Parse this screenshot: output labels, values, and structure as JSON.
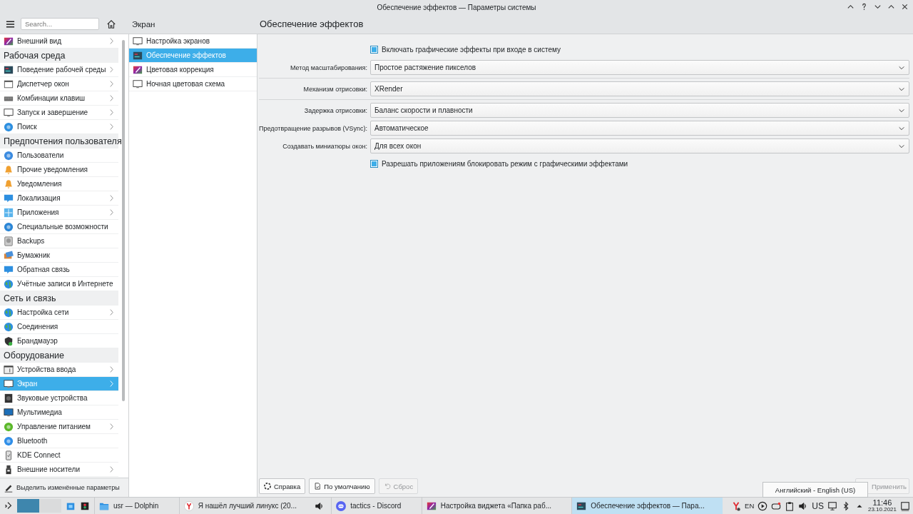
{
  "window": {
    "title": "Обеспечение эффектов — Параметры системы"
  },
  "toolbar": {
    "search_placeholder": "Search...",
    "breadcrumb": "Экран"
  },
  "sidebar": {
    "items": [
      {
        "kind": "item",
        "label": "Внешний вид",
        "has_children": true,
        "selected": false
      },
      {
        "kind": "category",
        "label": "Рабочая среда"
      },
      {
        "kind": "item",
        "label": "Поведение рабочей среды",
        "has_children": true,
        "selected": false
      },
      {
        "kind": "item",
        "label": "Диспетчер окон",
        "has_children": true,
        "selected": false
      },
      {
        "kind": "item",
        "label": "Комбинации клавиш",
        "has_children": true,
        "selected": false
      },
      {
        "kind": "item",
        "label": "Запуск и завершение",
        "has_children": true,
        "selected": false
      },
      {
        "kind": "item",
        "label": "Поиск",
        "has_children": true,
        "selected": false
      },
      {
        "kind": "category",
        "label": "Предпочтения пользователя"
      },
      {
        "kind": "item",
        "label": "Пользователи",
        "has_children": false,
        "selected": false
      },
      {
        "kind": "item",
        "label": "Прочие уведомления",
        "has_children": false,
        "selected": false
      },
      {
        "kind": "item",
        "label": "Уведомления",
        "has_children": false,
        "selected": false
      },
      {
        "kind": "item",
        "label": "Локализация",
        "has_children": true,
        "selected": false
      },
      {
        "kind": "item",
        "label": "Приложения",
        "has_children": true,
        "selected": false
      },
      {
        "kind": "item",
        "label": "Специальные возможности",
        "has_children": false,
        "selected": false
      },
      {
        "kind": "item",
        "label": "Backups",
        "has_children": false,
        "selected": false
      },
      {
        "kind": "item",
        "label": "Бумажник",
        "has_children": false,
        "selected": false
      },
      {
        "kind": "item",
        "label": "Обратная связь",
        "has_children": false,
        "selected": false
      },
      {
        "kind": "item",
        "label": "Учётные записи в Интернете",
        "has_children": false,
        "selected": false
      },
      {
        "kind": "category",
        "label": "Сеть и связь"
      },
      {
        "kind": "item",
        "label": "Настройка сети",
        "has_children": true,
        "selected": false
      },
      {
        "kind": "item",
        "label": "Соединения",
        "has_children": false,
        "selected": false
      },
      {
        "kind": "item",
        "label": "Брандмауэр",
        "has_children": false,
        "selected": false
      },
      {
        "kind": "category",
        "label": "Оборудование"
      },
      {
        "kind": "item",
        "label": "Устройства ввода",
        "has_children": true,
        "selected": false
      },
      {
        "kind": "item",
        "label": "Экран",
        "has_children": true,
        "selected": true
      },
      {
        "kind": "item",
        "label": "Звуковые устройства",
        "has_children": false,
        "selected": false
      },
      {
        "kind": "item",
        "label": "Мультимедиа",
        "has_children": false,
        "selected": false
      },
      {
        "kind": "item",
        "label": "Управление питанием",
        "has_children": true,
        "selected": false
      },
      {
        "kind": "item",
        "label": "Bluetooth",
        "has_children": false,
        "selected": false
      },
      {
        "kind": "item",
        "label": "KDE Connect",
        "has_children": false,
        "selected": false
      },
      {
        "kind": "item",
        "label": "Внешние носители",
        "has_children": true,
        "selected": false
      }
    ],
    "footer": "Выделить изменённые параметры"
  },
  "subpages": [
    {
      "label": "Настройка экранов",
      "selected": false
    },
    {
      "label": "Обеспечение эффектов",
      "selected": true
    },
    {
      "label": "Цветовая коррекция",
      "selected": false
    },
    {
      "label": "Ночная цветовая схема",
      "selected": false
    }
  ],
  "page": {
    "title": "Обеспечение эффектов",
    "options": [
      {
        "kind": "checkbox",
        "label": "Включать графические эффекты при входе в систему",
        "checked": true
      },
      {
        "kind": "select",
        "label": "Метод масштабирования:",
        "value": "Простое растяжение пикселов"
      },
      {
        "kind": "separator"
      },
      {
        "kind": "select",
        "label": "Механизм отрисовки:",
        "value": "XRender"
      },
      {
        "kind": "separator"
      },
      {
        "kind": "select",
        "label": "Задержка отрисовки:",
        "value": "Баланс скорости и плавности"
      },
      {
        "kind": "select",
        "label": "Предотвращение разрывов (VSync):",
        "value": "Автоматическое"
      },
      {
        "kind": "select",
        "label": "Создавать миниатюры окон:",
        "value": "Для всех окон"
      },
      {
        "kind": "checkbox",
        "label": "Разрешать приложениям блокировать режим с графическими эффектами",
        "checked": true
      }
    ]
  },
  "buttons": [
    {
      "label": "Справка",
      "disabled": false
    },
    {
      "label": "По умолчанию",
      "disabled": false
    },
    {
      "label": "Сброс",
      "disabled": true
    }
  ],
  "apply_button": {
    "label": "Применить",
    "disabled": true
  },
  "tooltip": "Английский - English (US)",
  "taskbar": {
    "pager": [
      {
        "selected": true
      },
      {
        "selected": false
      }
    ],
    "tasks": [
      {
        "label": "usr — Dolphin",
        "selected": false,
        "audio": false
      },
      {
        "label": "Я нашёл лучший линукс (20...",
        "selected": false,
        "audio": true
      },
      {
        "label": "tactics - Discord",
        "selected": false,
        "audio": false
      },
      {
        "label": "Настройка виджета «Папка раб...",
        "selected": false,
        "audio": false
      },
      {
        "label": "Обеспечение эффектов — Пара...",
        "selected": true,
        "audio": false
      }
    ],
    "keyboard": "EN",
    "layout": "US",
    "time": "11:46",
    "date": "23.10.2021"
  }
}
